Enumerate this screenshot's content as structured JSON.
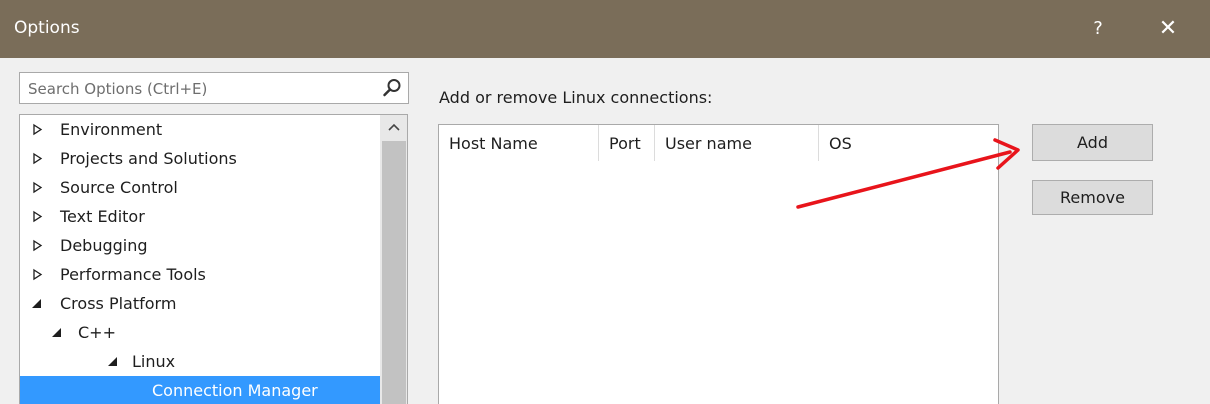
{
  "window": {
    "title": "Options",
    "help_label": "?",
    "close_label": "✕"
  },
  "search": {
    "placeholder": "Search Options (Ctrl+E)",
    "icon": "search-icon"
  },
  "tree": {
    "items": [
      {
        "label": "Environment",
        "state": "collapsed"
      },
      {
        "label": "Projects and Solutions",
        "state": "collapsed"
      },
      {
        "label": "Source Control",
        "state": "collapsed"
      },
      {
        "label": "Text Editor",
        "state": "collapsed"
      },
      {
        "label": "Debugging",
        "state": "collapsed"
      },
      {
        "label": "Performance Tools",
        "state": "collapsed"
      },
      {
        "label": "Cross Platform",
        "state": "expanded"
      },
      {
        "label": "C++",
        "state": "expanded"
      },
      {
        "label": "Linux",
        "state": "expanded"
      },
      {
        "label": "Connection Manager",
        "state": "leaf",
        "selected": true
      }
    ],
    "scroll_up_icon": "scroll-up-icon"
  },
  "connections": {
    "label": "Add or remove Linux connections:",
    "columns": [
      "Host Name",
      "Port",
      "User name",
      "OS"
    ],
    "rows": []
  },
  "buttons": {
    "add": "Add",
    "remove": "Remove"
  },
  "annotation": {
    "color": "#e8141b"
  }
}
